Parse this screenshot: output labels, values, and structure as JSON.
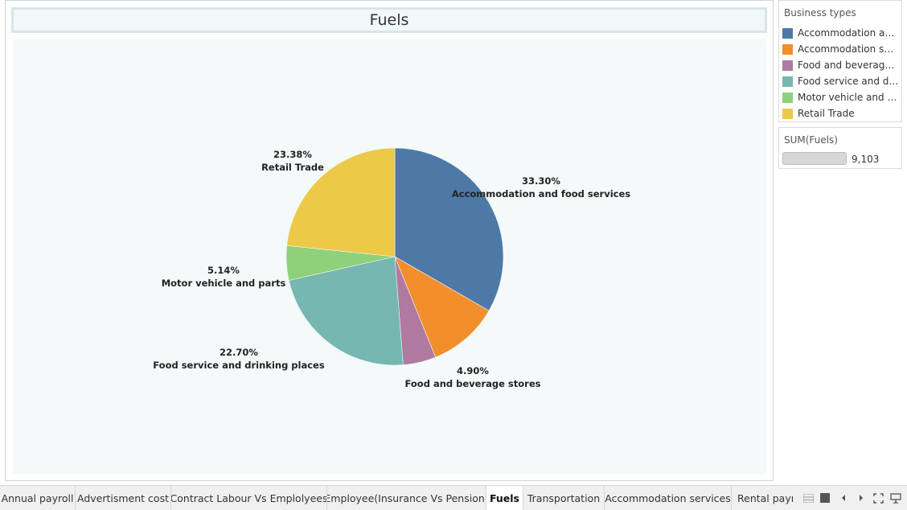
{
  "title": "Fuels",
  "legend": {
    "title": "Business types",
    "items": [
      {
        "label": "Accommodation and ..",
        "color": "#4e79a7"
      },
      {
        "label": "Accommodation serv..",
        "color": "#f28e2b"
      },
      {
        "label": "Food and beverage s..",
        "color": "#b07aa1"
      },
      {
        "label": "Food service and dri..",
        "color": "#76b7b2"
      },
      {
        "label": "Motor vehicle and pa..",
        "color": "#8fd17b"
      },
      {
        "label": "Retail Trade",
        "color": "#edc948"
      }
    ]
  },
  "size_legend": {
    "title": "SUM(Fuels)",
    "value": "9,103"
  },
  "chart_data": {
    "type": "pie",
    "title": "Fuels",
    "slices": [
      {
        "name": "Accommodation and food services",
        "percent": 33.3,
        "percent_label": "33.30%",
        "label": "Accommodation and food services",
        "color": "#4e79a7"
      },
      {
        "name": "Accommodation services",
        "percent": 10.58,
        "percent_label": "",
        "label": "",
        "color": "#f28e2b"
      },
      {
        "name": "Food and beverage stores",
        "percent": 4.9,
        "percent_label": "4.90%",
        "label": "Food and beverage stores",
        "color": "#b07aa1"
      },
      {
        "name": "Food service and drinking places",
        "percent": 22.7,
        "percent_label": "22.70%",
        "label": "Food service and drinking places",
        "color": "#76b7b2"
      },
      {
        "name": "Motor vehicle and parts",
        "percent": 5.14,
        "percent_label": "5.14%",
        "label": "Motor vehicle and parts",
        "color": "#8fd17b"
      },
      {
        "name": "Retail Trade",
        "percent": 23.38,
        "percent_label": "23.38%",
        "label": "Retail Trade",
        "color": "#edc948"
      }
    ]
  },
  "tabs": [
    {
      "label": "Annual payroll",
      "active": false
    },
    {
      "label": "Advertisment cost",
      "active": false
    },
    {
      "label": "Contract Labour Vs Emplolyees",
      "active": false
    },
    {
      "label": "Employee(Insurance Vs Pension)",
      "active": false
    },
    {
      "label": "Fuels",
      "active": true
    },
    {
      "label": "Transportation",
      "active": false
    },
    {
      "label": "Accommodation services",
      "active": false
    },
    {
      "label": "Rental paym",
      "active": false
    }
  ],
  "controls": [
    {
      "icon": "grid-view-icon"
    },
    {
      "icon": "square-view-icon"
    },
    {
      "icon": "previous-arrow-icon"
    },
    {
      "icon": "next-arrow-icon"
    },
    {
      "icon": "fullscreen-icon"
    },
    {
      "icon": "presentation-icon"
    }
  ]
}
